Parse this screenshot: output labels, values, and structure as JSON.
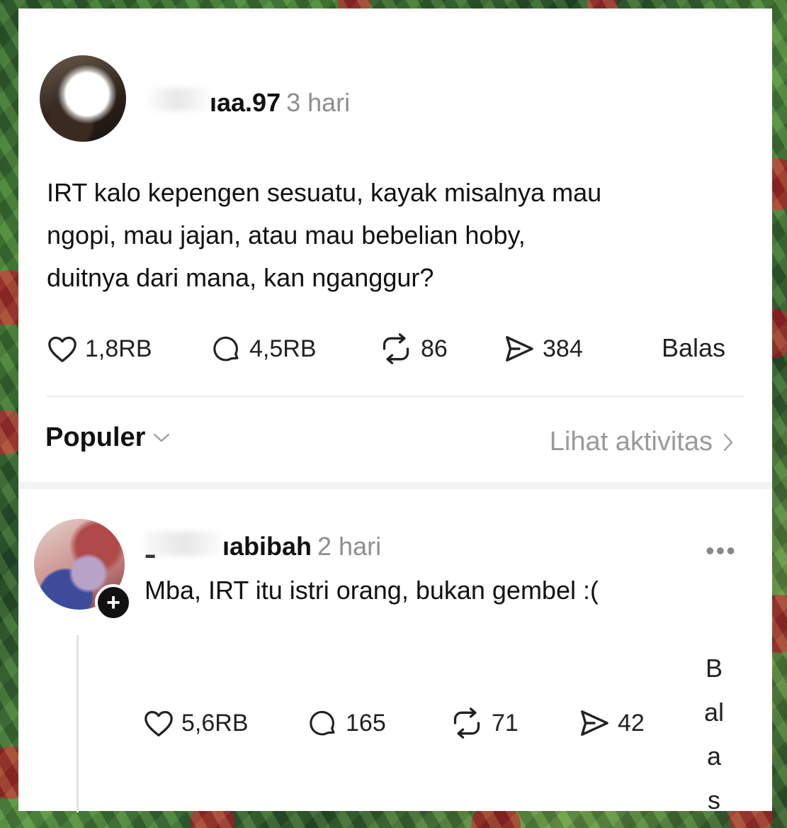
{
  "post": {
    "username": "ıaa.97",
    "time": "3 hari",
    "text_lines": [
      "IRT kalo kepengen sesuatu, kayak misalnya mau",
      "ngopi, mau jajan, atau mau bebelian hoby,",
      "duitnya dari mana, kan nganggur?"
    ],
    "likes": "1,8RB",
    "comments": "4,5RB",
    "reposts": "86",
    "shares": "384",
    "reply_label": "Balas"
  },
  "sort": {
    "label": "Populer",
    "activity_label": "Lihat aktivitas"
  },
  "reply": {
    "username_prefix": "ـ",
    "username": "ıabibah",
    "time": "2 hari",
    "more": "•••",
    "text": "Mba, IRT itu istri orang, bukan gembel :(",
    "likes": "5,6RB",
    "comments": "165",
    "reposts": "71",
    "shares": "42",
    "reply_label_chars": [
      "B",
      "al",
      "a",
      "s"
    ]
  },
  "icons": {
    "like": "heart-icon",
    "comment": "comment-bubble-icon",
    "repost": "repost-icon",
    "share": "send-icon",
    "sort": "chevron-down-icon",
    "activity": "chevron-right-icon",
    "follow": "plus-icon"
  }
}
